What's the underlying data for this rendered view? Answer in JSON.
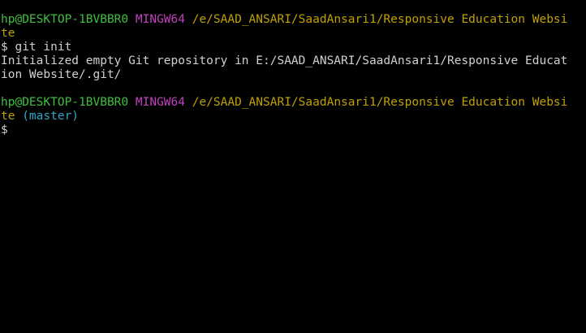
{
  "terminal": {
    "lines": [
      {
        "user_host": "hp@DESKTOP-1BVBBR0",
        "env": "MINGW64",
        "path_part1": "/e/SAAD_ANSARI/SaadAnsari1/Responsive Education Websi",
        "path_part2": "te"
      },
      {
        "prompt": "$",
        "command": "git init"
      },
      {
        "output_part1": "Initialized empty Git repository in E:/SAAD_ANSARI/SaadAnsari1/Responsive Educat",
        "output_part2": "ion Website/.git/"
      },
      {
        "user_host": "hp@DESKTOP-1BVBBR0",
        "env": "MINGW64",
        "path_part1": "/e/SAAD_ANSARI/SaadAnsari1/Responsive Education Websi",
        "path_part2": "te",
        "branch": "(master)"
      },
      {
        "prompt": "$"
      }
    ]
  },
  "colors": {
    "background": "#000000",
    "user_host": "#3fbf3f",
    "env": "#c040c0",
    "path": "#c0a000",
    "branch": "#2fa8c8",
    "text": "#d0d0d0"
  }
}
